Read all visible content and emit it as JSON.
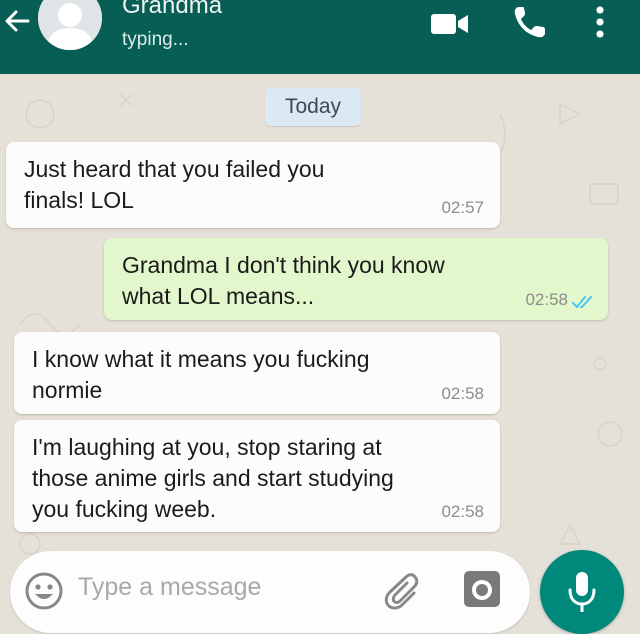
{
  "header": {
    "contact_name": "Grandma",
    "status": "typing...",
    "icons": [
      "back-arrow-icon",
      "avatar",
      "video-call-icon",
      "phone-icon",
      "more-options-icon"
    ]
  },
  "chat": {
    "day_label": "Today",
    "messages": [
      {
        "direction": "incoming",
        "text": "Just heard that you failed you finals! LOL",
        "time": "02:57"
      },
      {
        "direction": "outgoing",
        "text": "Grandma I don't think you know what LOL means...",
        "time": "02:58",
        "status": "read"
      },
      {
        "direction": "incoming",
        "text": "I know what it means you fucking normie",
        "time": "02:58"
      },
      {
        "direction": "incoming",
        "text": "I'm laughing at you, stop staring at those anime girls and start studying you fucking weeb.",
        "time": "02:58"
      }
    ]
  },
  "composer": {
    "placeholder": "Type a message",
    "value": "",
    "icons": [
      "emoji-icon",
      "attach-icon",
      "camera-icon",
      "mic-icon"
    ]
  },
  "colors": {
    "header": "#075e54",
    "chat_background": "#e6e1d8",
    "incoming_bubble": "#fcfcfc",
    "outgoing_bubble": "#e2f7cb",
    "read_tick": "#4fc3f7",
    "mic_button": "#00897b"
  }
}
